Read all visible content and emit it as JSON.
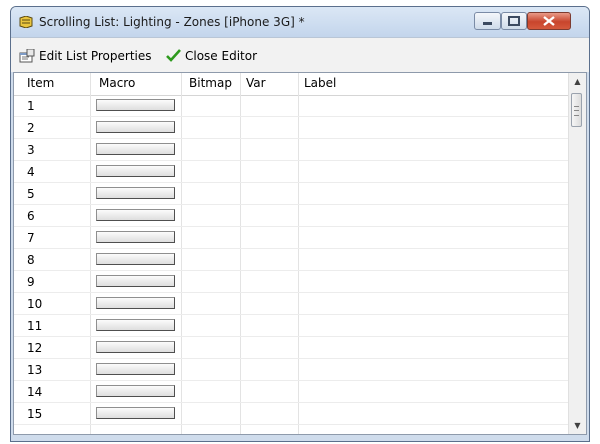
{
  "window": {
    "title": "Scrolling List: Lighting - Zones [iPhone 3G] *"
  },
  "toolbar": {
    "edit_label": "Edit List Properties",
    "close_label": "Close Editor"
  },
  "table": {
    "columns": [
      "Item",
      "Macro",
      "Bitmap",
      "Var",
      "Label"
    ],
    "rows": [
      {
        "item": "1"
      },
      {
        "item": "2"
      },
      {
        "item": "3"
      },
      {
        "item": "4"
      },
      {
        "item": "5"
      },
      {
        "item": "6"
      },
      {
        "item": "7"
      },
      {
        "item": "8"
      },
      {
        "item": "9"
      },
      {
        "item": "10"
      },
      {
        "item": "11"
      },
      {
        "item": "12"
      },
      {
        "item": "13"
      },
      {
        "item": "14"
      },
      {
        "item": "15"
      }
    ]
  },
  "icons": {
    "app": "app-icon",
    "edit": "properties-icon",
    "close": "check-icon"
  },
  "colors": {
    "accent_check": "#2e9a1e",
    "title_bar": "#c3d5ec",
    "close_button": "#c8452d"
  }
}
